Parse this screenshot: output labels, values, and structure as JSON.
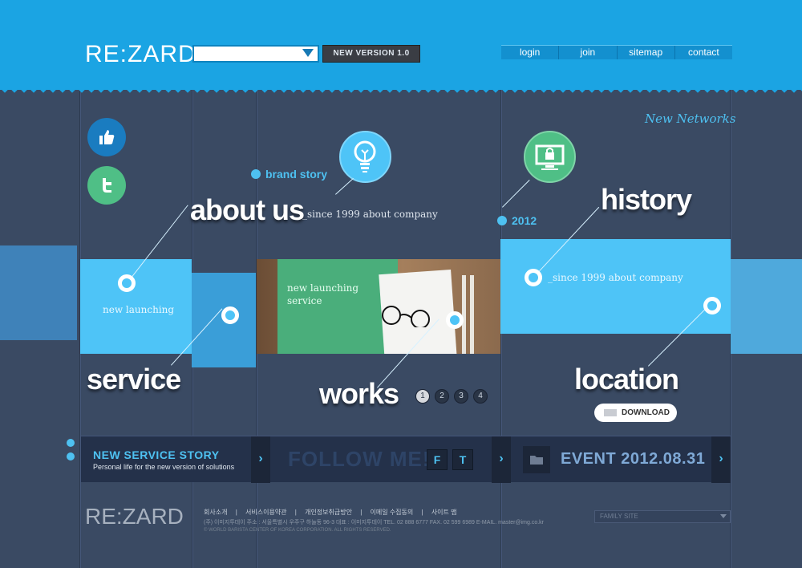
{
  "header": {
    "logo": "RE:ZARD",
    "version_label": "NEW VERSION 1.0",
    "nav": [
      "login",
      "join",
      "sitemap",
      "contact"
    ]
  },
  "tagline": "New Networks",
  "brand_story": "brand story",
  "year": "2012",
  "about": {
    "title": "about us",
    "sub": "_since 1999 about company"
  },
  "history": {
    "title": "history",
    "sub": "_since 1999 about company"
  },
  "launch_text": "new launching",
  "photo_caption": "new launching service",
  "service_title": "service",
  "works_title": "works",
  "location_title": "location",
  "pages": [
    "1",
    "2",
    "3",
    "4"
  ],
  "download": "DOWNLOAD",
  "bars": {
    "story_title": "NEW  SERVICE  STORY",
    "story_sub": "Personal life for the new version of solutions",
    "follow": "FOLLOW  ME!",
    "follow_f": "F",
    "follow_t": "T",
    "event": "EVENT  2012.08.31"
  },
  "footer": {
    "logo": "RE:ZARD",
    "links": [
      "회사소개",
      "|",
      "서비스이용약관",
      "|",
      "개인정보취급방안",
      "|",
      "이메일 수집동의",
      "|",
      "사이트 맵"
    ],
    "address": "(주) 이미지투데이    주소 : 서울특별시 우주구 하늘동 96-3    대표 : 이미지투데이    TEL. 02 888 6777  FAX. 02 599 6989 E-MAIL. master@img.co.kr",
    "copyright": "© WORLD BARISTA CENTER OF KOREA CORPORATION. ALL RIGHTS RESERVED.",
    "family_site": "FAMILY SITE"
  },
  "colors": {
    "accent": "#1ba4e3",
    "light_blue": "#4ec4f7",
    "green": "#4fbf86",
    "background": "#3a4a63"
  }
}
